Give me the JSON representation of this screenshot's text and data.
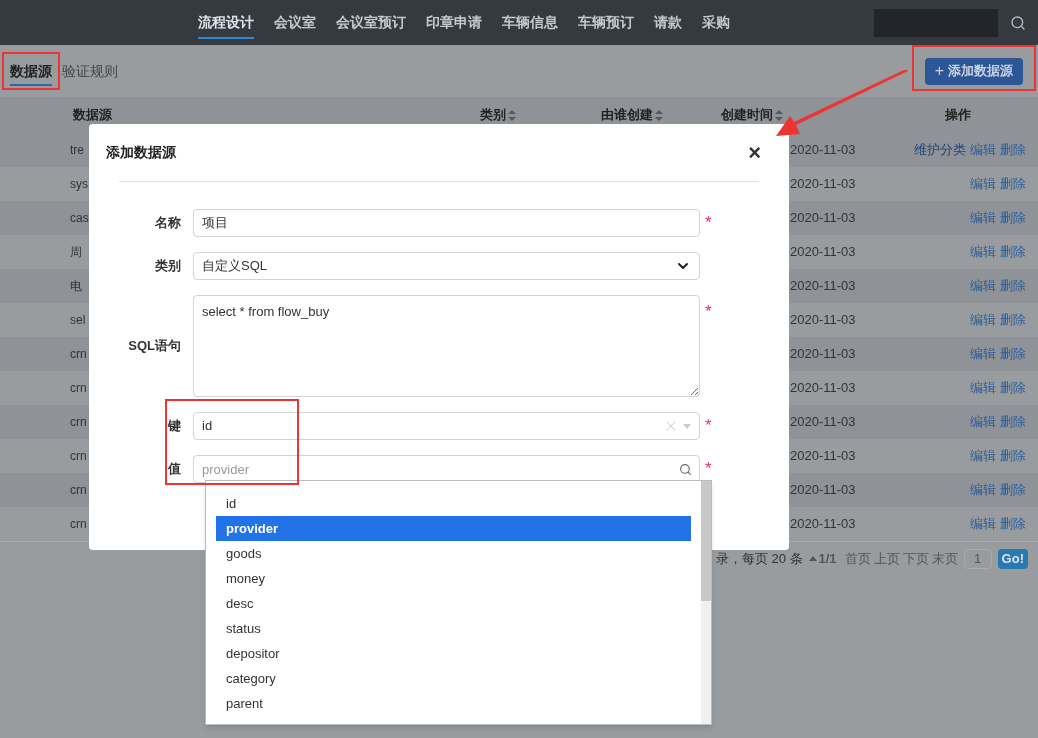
{
  "nav": {
    "items": [
      {
        "label": "流程设计",
        "selected": true
      },
      {
        "label": "会议室",
        "selected": false
      },
      {
        "label": "会议室预订",
        "selected": false
      },
      {
        "label": "印章申请",
        "selected": false
      },
      {
        "label": "车辆信息",
        "selected": false
      },
      {
        "label": "车辆预订",
        "selected": false
      },
      {
        "label": "请款",
        "selected": false
      },
      {
        "label": "采购",
        "selected": false
      }
    ]
  },
  "tabs": [
    {
      "label": "数据源",
      "selected": true
    },
    {
      "label": "验证规则",
      "selected": false
    }
  ],
  "add_button": {
    "icon": "+",
    "label": "添加数据源"
  },
  "table": {
    "columns": [
      {
        "label": "数据源",
        "sortable": false
      },
      {
        "label": "类别",
        "sortable": true
      },
      {
        "label": "由谁创建",
        "sortable": true
      },
      {
        "label": "创建时间",
        "sortable": true
      },
      {
        "label": "操作",
        "sortable": false
      }
    ],
    "rows": [
      {
        "name": "tre",
        "date": "2020-11-03",
        "actions": [
          "维护分类",
          "编辑",
          "删除"
        ]
      },
      {
        "name": "sys",
        "date": "2020-11-03",
        "actions": [
          "编辑",
          "删除"
        ]
      },
      {
        "name": "cas",
        "date": "2020-11-03",
        "actions": [
          "编辑",
          "删除"
        ]
      },
      {
        "name": "周",
        "date": "2020-11-03",
        "actions": [
          "编辑",
          "删除"
        ]
      },
      {
        "name": "电",
        "date": "2020-11-03",
        "actions": [
          "编辑",
          "删除"
        ]
      },
      {
        "name": "sel",
        "date": "2020-11-03",
        "actions": [
          "编辑",
          "删除"
        ]
      },
      {
        "name": "crn",
        "date": "2020-11-03",
        "actions": [
          "编辑",
          "删除"
        ]
      },
      {
        "name": "crn",
        "date": "2020-11-03",
        "actions": [
          "编辑",
          "删除"
        ]
      },
      {
        "name": "crn",
        "date": "2020-11-03",
        "actions": [
          "编辑",
          "删除"
        ]
      },
      {
        "name": "crn",
        "date": "2020-11-03",
        "actions": [
          "编辑",
          "删除"
        ]
      },
      {
        "name": "crn",
        "date": "2020-11-03",
        "actions": [
          "编辑",
          "删除"
        ]
      },
      {
        "name": "crn",
        "date": "2020-11-03",
        "actions": [
          "编辑",
          "删除"
        ]
      }
    ]
  },
  "pagination": {
    "summary": "录，每页 20 条",
    "page": "1/1",
    "links": [
      "首页",
      "上页",
      "下页",
      "末页"
    ],
    "page_input": "1",
    "go": "Go!"
  },
  "dialog": {
    "title": "添加数据源",
    "close": "×",
    "required_mark": "*",
    "fields": [
      {
        "kind": "text",
        "label": "名称",
        "value": "项目",
        "required": true
      },
      {
        "kind": "select",
        "label": "类别",
        "value": "自定义SQL",
        "required": false
      },
      {
        "kind": "textarea",
        "label": "SQL语句",
        "value": "select * from flow_buy",
        "required": true
      },
      {
        "kind": "combo",
        "label": "键",
        "value": "id",
        "required": true
      },
      {
        "kind": "search",
        "label": "值",
        "placeholder": "provider",
        "required": true
      }
    ],
    "dropdown": [
      {
        "label": "id",
        "selected": false
      },
      {
        "label": "provider",
        "selected": true
      },
      {
        "label": "goods",
        "selected": false
      },
      {
        "label": "money",
        "selected": false
      },
      {
        "label": "desc",
        "selected": false
      },
      {
        "label": "status",
        "selected": false
      },
      {
        "label": "depositor",
        "selected": false
      },
      {
        "label": "category",
        "selected": false
      },
      {
        "label": "parent",
        "selected": false
      }
    ]
  }
}
